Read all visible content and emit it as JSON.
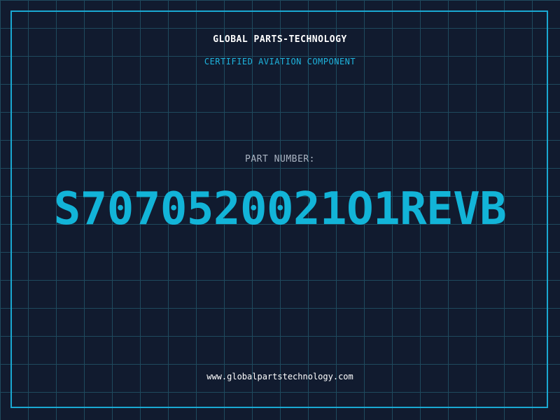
{
  "header": {
    "brand": "GLOBAL PARTS-TECHNOLOGY",
    "tagline": "CERTIFIED AVIATION COMPONENT"
  },
  "part": {
    "label": "PART NUMBER:",
    "number": "S7070520021O1REVB"
  },
  "footer": {
    "url": "www.globalpartstechnology.com"
  },
  "colors": {
    "background": "#111b2f",
    "grid": "#1f4a5e",
    "frame": "#1aa8d2",
    "accent": "#12b4d8",
    "label": "#aab4c2",
    "text": "#ffffff"
  }
}
